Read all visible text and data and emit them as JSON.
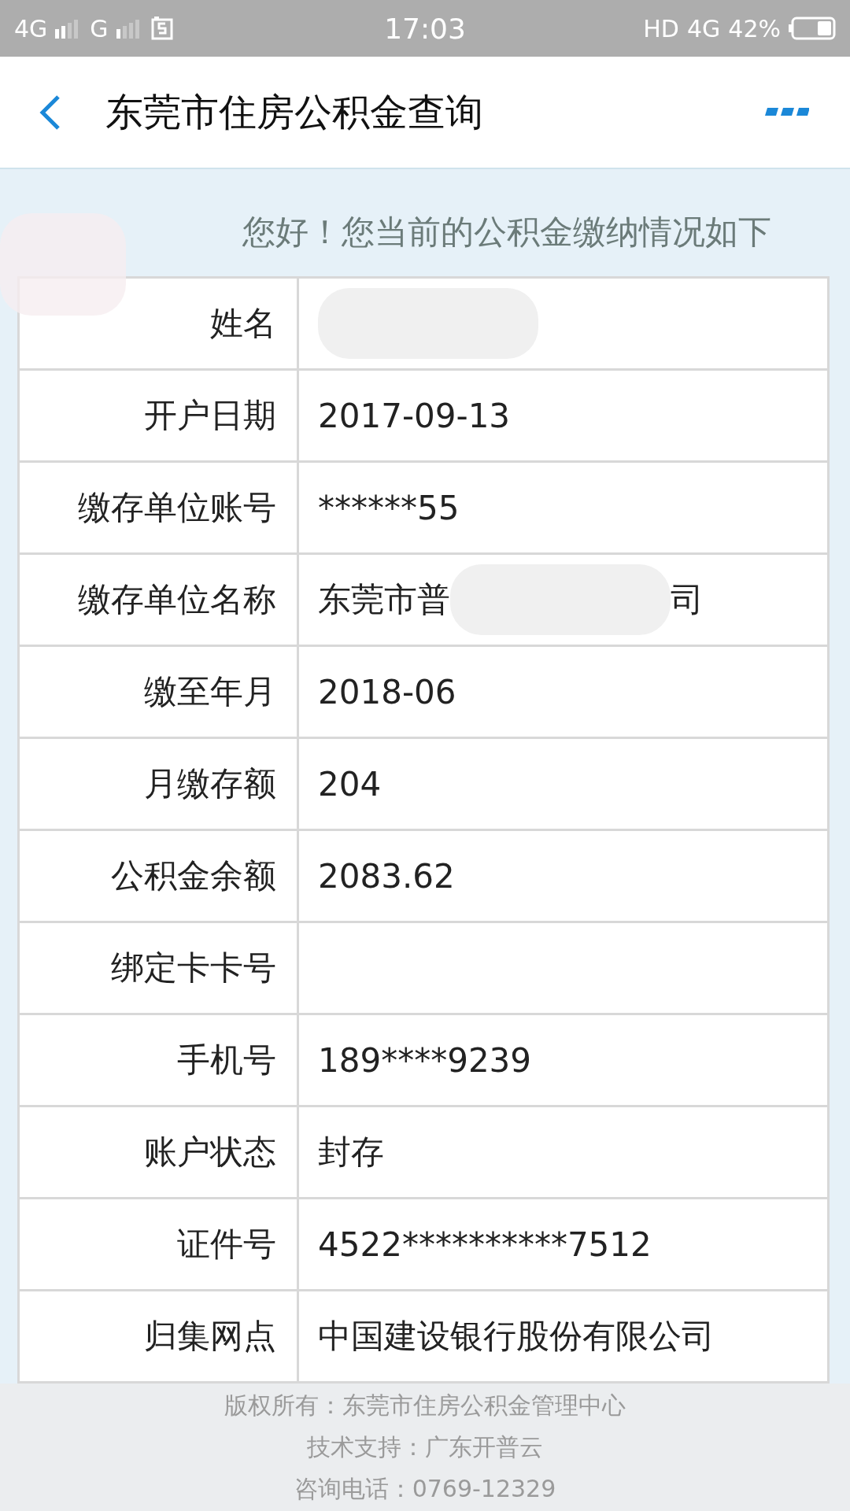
{
  "status_bar": {
    "network_1": "4G",
    "network_2": "G",
    "time": "17:03",
    "hd": "HD",
    "network_3": "4G",
    "battery": "42%"
  },
  "header": {
    "title": "东莞市住房公积金查询"
  },
  "greeting": "您好！您当前的公积金缴纳情况如下",
  "rows": [
    {
      "label": "姓名",
      "parts": [
        {
          "kind": "redacted"
        }
      ]
    },
    {
      "label": "开户日期",
      "parts": [
        {
          "kind": "text",
          "text": "2017-09-13"
        }
      ]
    },
    {
      "label": "缴存单位账号",
      "parts": [
        {
          "kind": "text",
          "text": "******55"
        }
      ]
    },
    {
      "label": "缴存单位名称",
      "parts": [
        {
          "kind": "text",
          "text": "东莞市普"
        },
        {
          "kind": "redacted"
        },
        {
          "kind": "text",
          "text": "司"
        }
      ]
    },
    {
      "label": "缴至年月",
      "parts": [
        {
          "kind": "text",
          "text": "2018-06"
        }
      ]
    },
    {
      "label": "月缴存额",
      "parts": [
        {
          "kind": "text",
          "text": "204"
        }
      ]
    },
    {
      "label": "公积金余额",
      "parts": [
        {
          "kind": "text",
          "text": "2083.62"
        }
      ]
    },
    {
      "label": "绑定卡卡号",
      "parts": []
    },
    {
      "label": "手机号",
      "parts": [
        {
          "kind": "text",
          "text": "189****9239"
        }
      ]
    },
    {
      "label": "账户状态",
      "parts": [
        {
          "kind": "text",
          "text": "封存"
        }
      ]
    },
    {
      "label": "证件号",
      "parts": [
        {
          "kind": "text",
          "text": "4522**********7512"
        }
      ]
    },
    {
      "label": "归集网点",
      "parts": [
        {
          "kind": "text",
          "text": "中国建设银行股份有限公司"
        }
      ]
    }
  ],
  "footer": [
    "版权所有：东莞市住房公积金管理中心",
    "技术支持：广东开普云",
    "咨询电话：0769-12329"
  ]
}
